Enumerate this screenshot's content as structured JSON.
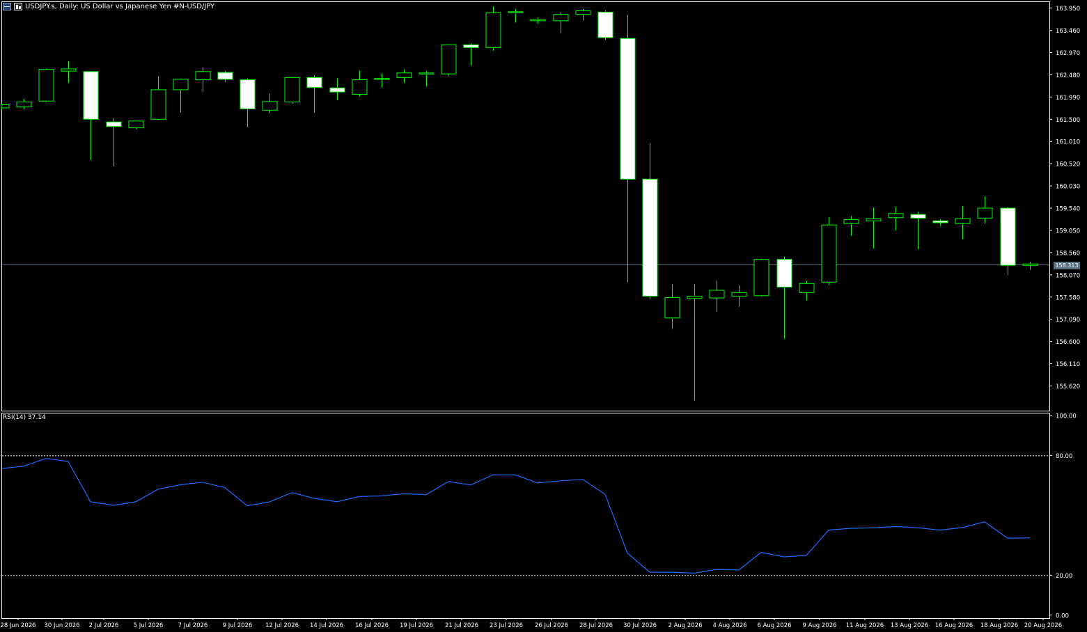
{
  "header": {
    "title": "USDJPY.s, Daily:  US Dollar vs  Japanese Yen #N-USD/JPY"
  },
  "icons": [
    "window-menu-icon",
    "chart-type-icon"
  ],
  "colors": {
    "background": "#000000",
    "candle_outline": "#00ff00",
    "bull_body": "#000000",
    "bear_body": "#ffffff",
    "grid_axis": "#ffffff",
    "rsi_line": "#1e6bff",
    "current_price_line": "#5b6f83"
  },
  "current_price": "158.313",
  "rsi": {
    "label": "RSI(14) 37.14",
    "levels": [
      "100.00",
      "80.00",
      "20.00",
      "0.00"
    ]
  },
  "chart_data": {
    "type": "candlestick",
    "price_axis": {
      "ticks": [
        "163.950",
        "163.460",
        "162.970",
        "162.480",
        "161.990",
        "161.500",
        "161.010",
        "160.520",
        "160.030",
        "159.540",
        "159.050",
        "158.560",
        "158.070",
        "157.580",
        "157.090",
        "156.600",
        "156.110",
        "155.620"
      ],
      "ylim": [
        155.2,
        164.1
      ]
    },
    "date_ticks": [
      "28 Jun 2026",
      "30 Jun 2026",
      "2 Jul 2026",
      "5 Jul 2026",
      "7 Jul 2026",
      "9 Jul 2026",
      "12 Jul 2026",
      "14 Jul 2026",
      "16 Jul 2026",
      "19 Jul 2026",
      "21 Jul 2026",
      "23 Jul 2026",
      "26 Jul 2026",
      "28 Jul 2026",
      "30 Jul 2026",
      "2 Aug 2026",
      "4 Aug 2026",
      "6 Aug 2026",
      "9 Aug 2026",
      "11 Aug 2026",
      "13 Aug 2026",
      "16 Aug 2026",
      "18 Aug 2026",
      "20 Aug 2026"
    ],
    "candles": [
      {
        "o": 161.75,
        "h": 161.85,
        "l": 161.7,
        "c": 161.82
      },
      {
        "o": 161.77,
        "h": 161.95,
        "l": 161.72,
        "c": 161.88
      },
      {
        "o": 161.9,
        "h": 162.62,
        "l": 161.88,
        "c": 162.6
      },
      {
        "o": 162.56,
        "h": 162.78,
        "l": 162.3,
        "c": 162.61
      },
      {
        "o": 162.55,
        "h": 162.56,
        "l": 160.6,
        "c": 161.5
      },
      {
        "o": 161.44,
        "h": 161.52,
        "l": 160.46,
        "c": 161.34
      },
      {
        "o": 161.31,
        "h": 161.46,
        "l": 161.28,
        "c": 161.46
      },
      {
        "o": 161.5,
        "h": 162.45,
        "l": 161.48,
        "c": 162.15
      },
      {
        "o": 162.15,
        "h": 162.4,
        "l": 161.65,
        "c": 162.38
      },
      {
        "o": 162.37,
        "h": 162.65,
        "l": 162.1,
        "c": 162.55
      },
      {
        "o": 162.53,
        "h": 162.57,
        "l": 162.32,
        "c": 162.38
      },
      {
        "o": 162.37,
        "h": 162.4,
        "l": 161.32,
        "c": 161.73
      },
      {
        "o": 161.7,
        "h": 162.06,
        "l": 161.63,
        "c": 161.89
      },
      {
        "o": 161.88,
        "h": 162.43,
        "l": 161.84,
        "c": 162.42
      },
      {
        "o": 162.42,
        "h": 162.47,
        "l": 161.64,
        "c": 162.2
      },
      {
        "o": 162.19,
        "h": 162.4,
        "l": 161.92,
        "c": 162.1
      },
      {
        "o": 162.05,
        "h": 162.57,
        "l": 162.0,
        "c": 162.37
      },
      {
        "o": 162.4,
        "h": 162.51,
        "l": 162.2,
        "c": 162.4
      },
      {
        "o": 162.42,
        "h": 162.6,
        "l": 162.3,
        "c": 162.52
      },
      {
        "o": 162.5,
        "h": 162.56,
        "l": 162.22,
        "c": 162.52
      },
      {
        "o": 162.5,
        "h": 163.15,
        "l": 162.46,
        "c": 163.14
      },
      {
        "o": 163.14,
        "h": 163.17,
        "l": 162.68,
        "c": 163.08
      },
      {
        "o": 163.08,
        "h": 163.99,
        "l": 163.01,
        "c": 163.85
      },
      {
        "o": 163.86,
        "h": 163.93,
        "l": 163.63,
        "c": 163.87
      },
      {
        "o": 163.67,
        "h": 163.74,
        "l": 163.6,
        "c": 163.7
      },
      {
        "o": 163.67,
        "h": 163.86,
        "l": 163.4,
        "c": 163.81
      },
      {
        "o": 163.81,
        "h": 163.93,
        "l": 163.68,
        "c": 163.89
      },
      {
        "o": 163.86,
        "h": 163.9,
        "l": 163.25,
        "c": 163.3
      },
      {
        "o": 163.28,
        "h": 163.8,
        "l": 157.91,
        "c": 160.18
      },
      {
        "o": 160.18,
        "h": 160.98,
        "l": 157.53,
        "c": 157.6
      },
      {
        "o": 157.12,
        "h": 157.86,
        "l": 156.88,
        "c": 157.57
      },
      {
        "o": 157.55,
        "h": 157.86,
        "l": 155.3,
        "c": 157.6
      },
      {
        "o": 157.56,
        "h": 157.94,
        "l": 157.25,
        "c": 157.73
      },
      {
        "o": 157.6,
        "h": 157.84,
        "l": 157.37,
        "c": 157.68
      },
      {
        "o": 157.61,
        "h": 158.43,
        "l": 157.59,
        "c": 158.41
      },
      {
        "o": 158.41,
        "h": 158.47,
        "l": 156.66,
        "c": 157.8
      },
      {
        "o": 157.68,
        "h": 157.94,
        "l": 157.51,
        "c": 157.88
      },
      {
        "o": 157.91,
        "h": 159.34,
        "l": 157.84,
        "c": 159.17
      },
      {
        "o": 159.2,
        "h": 159.36,
        "l": 158.93,
        "c": 159.29
      },
      {
        "o": 159.26,
        "h": 159.55,
        "l": 158.65,
        "c": 159.31
      },
      {
        "o": 159.33,
        "h": 159.57,
        "l": 159.05,
        "c": 159.42
      },
      {
        "o": 159.4,
        "h": 159.46,
        "l": 158.63,
        "c": 159.32
      },
      {
        "o": 159.26,
        "h": 159.3,
        "l": 159.15,
        "c": 159.22
      },
      {
        "o": 159.2,
        "h": 159.58,
        "l": 158.85,
        "c": 159.31
      },
      {
        "o": 159.32,
        "h": 159.8,
        "l": 159.2,
        "c": 159.54
      },
      {
        "o": 159.54,
        "h": 159.56,
        "l": 158.06,
        "c": 158.28
      },
      {
        "o": 158.28,
        "h": 158.36,
        "l": 158.18,
        "c": 158.31
      }
    ],
    "rsi_values": [
      73.5,
      74.6,
      78.5,
      77.0,
      56.8,
      55.0,
      56.8,
      63.1,
      65.3,
      66.6,
      63.9,
      54.8,
      56.7,
      61.4,
      58.5,
      56.8,
      59.4,
      59.8,
      60.8,
      60.4,
      66.9,
      65.2,
      70.3,
      70.3,
      66.2,
      67.3,
      68.0,
      60.5,
      31.1,
      21.5,
      21.5,
      21.0,
      22.9,
      22.6,
      31.4,
      29.2,
      29.9,
      42.6,
      43.5,
      43.7,
      44.4,
      43.8,
      42.6,
      43.9,
      46.7,
      38.6,
      38.7
    ]
  }
}
